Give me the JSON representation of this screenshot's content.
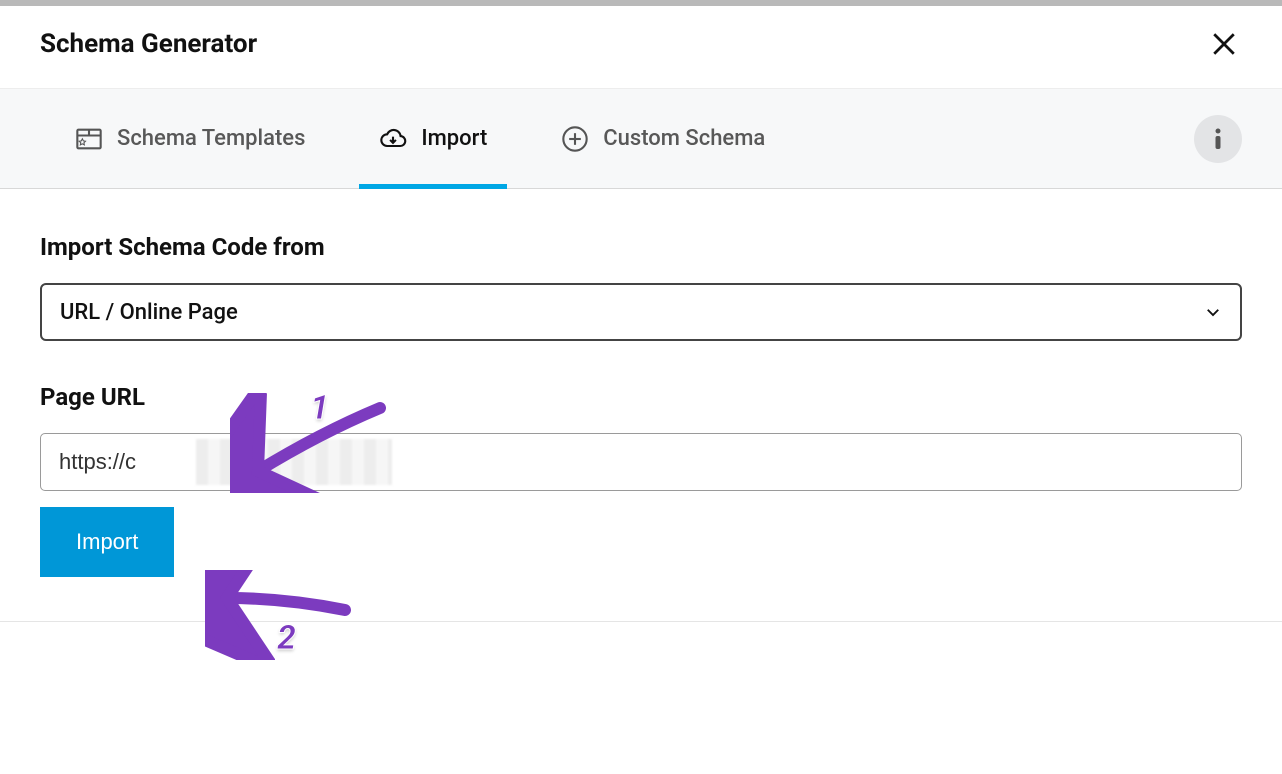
{
  "modal": {
    "title": "Schema Generator"
  },
  "tabs": {
    "templates": "Schema Templates",
    "import": "Import",
    "custom": "Custom Schema"
  },
  "importSection": {
    "sourceLabel": "Import Schema Code from",
    "sourceValue": "URL / Online Page",
    "urlLabel": "Page URL",
    "urlValue": "https://c                        .com",
    "importButton": "Import"
  },
  "annotations": {
    "one": "1",
    "two": "2"
  },
  "colors": {
    "accent": "#00a7e5",
    "annotation": "#7c3bbf"
  }
}
